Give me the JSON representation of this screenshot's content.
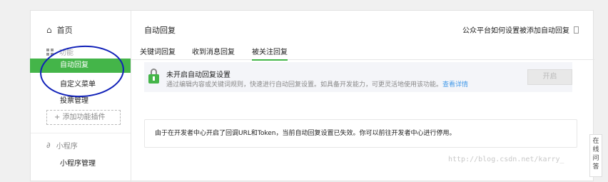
{
  "sidebar": {
    "home": {
      "icon": "home-icon",
      "label": "首页"
    },
    "group": {
      "icon": "grid-icon",
      "label": "功能"
    },
    "items": [
      {
        "label": "自动回复",
        "active": true
      },
      {
        "label": "自定义菜单"
      },
      {
        "label": "投票管理"
      }
    ],
    "add_plugin": "+ 添加功能插件",
    "mini_program": {
      "icon": "link-icon",
      "label": "小程序",
      "sub": "小程序管理"
    }
  },
  "main": {
    "title": "自动回复",
    "help_link": "公众平台如何设置被添加自动回复",
    "tabs": [
      {
        "label": "关键词回复"
      },
      {
        "label": "收到消息回复"
      },
      {
        "label": "被关注回复",
        "active": true
      }
    ],
    "notice": {
      "title": "未开启自动回复设置",
      "description": "通过编辑内容或关键词规则，快速进行自动回复设置。如具备开发能力，可更灵活地使用该功能。",
      "link": "查看详情",
      "button": "开启"
    },
    "message": "由于在开发者中心开启了回调URL和Token，当前自动回复设置已失效。你可以前往开发者中心进行停用。"
  },
  "overlay": {
    "watermark": "http://blog.csdn.net/karry_",
    "online_help": "在线问答"
  },
  "colors": {
    "accent": "#44b549",
    "link": "#459ae9",
    "annotation": "#1020b8"
  }
}
